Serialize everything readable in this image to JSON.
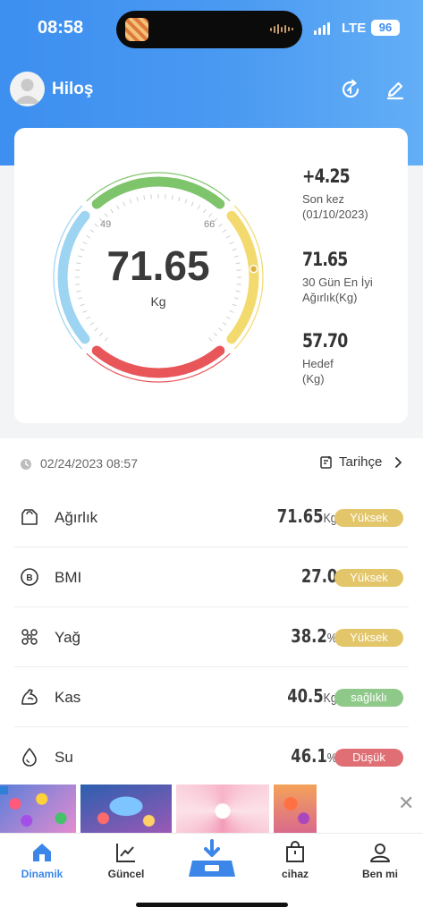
{
  "status_bar": {
    "time": "08:58",
    "network": "LTE",
    "battery": "96"
  },
  "header": {
    "username": "Hiloş"
  },
  "gauge": {
    "value": "71.65",
    "unit": "Kg",
    "range_min": "49",
    "range_max": "66"
  },
  "stats": [
    {
      "value": "+4.25",
      "label_line1": "Son kez",
      "label_line2": "(01/10/2023)"
    },
    {
      "value": "71.65",
      "label_line1": "30 Gün En İyi",
      "label_line2": "Ağırlık(Kg)"
    },
    {
      "value": "57.70",
      "label_line1": "Hedef",
      "label_line2": "(Kg)"
    }
  ],
  "measurement": {
    "date": "02/24/2023 08:57",
    "history_label": "Tarihçe"
  },
  "metrics": [
    {
      "label": "Ağırlık",
      "value": "71.65",
      "unit": "Kg",
      "status": "Yüksek",
      "status_color": "#e3c66a",
      "icon": "weight-icon"
    },
    {
      "label": "BMI",
      "value": "27.0",
      "unit": "",
      "status": "Yüksek",
      "status_color": "#e3c66a",
      "icon": "bmi-icon"
    },
    {
      "label": "Yağ",
      "value": "38.2",
      "unit": "%",
      "status": "Yüksek",
      "status_color": "#e3c66a",
      "icon": "fat-icon"
    },
    {
      "label": "Kas",
      "value": "40.5",
      "unit": "Kg",
      "status": "sağlıklı",
      "status_color": "#8fc98a",
      "icon": "muscle-icon"
    },
    {
      "label": "Su",
      "value": "46.1",
      "unit": "%",
      "status": "Düşük",
      "status_color": "#df6f74",
      "icon": "water-icon"
    }
  ],
  "tabs": [
    {
      "label": "Dinamik",
      "active": true,
      "icon": "home-icon"
    },
    {
      "label": "Güncel",
      "active": false,
      "icon": "trend-chart-icon"
    },
    {
      "label": "cihaz",
      "active": false,
      "icon": "device-bag-icon"
    },
    {
      "label": "Ben mi",
      "active": false,
      "icon": "profile-icon"
    }
  ],
  "colors": {
    "accent": "#3b86e8",
    "gauge_green": "#7ec46b",
    "gauge_yellow": "#f2da6e",
    "gauge_red": "#e8565a",
    "gauge_blue": "#9dd4f2"
  }
}
